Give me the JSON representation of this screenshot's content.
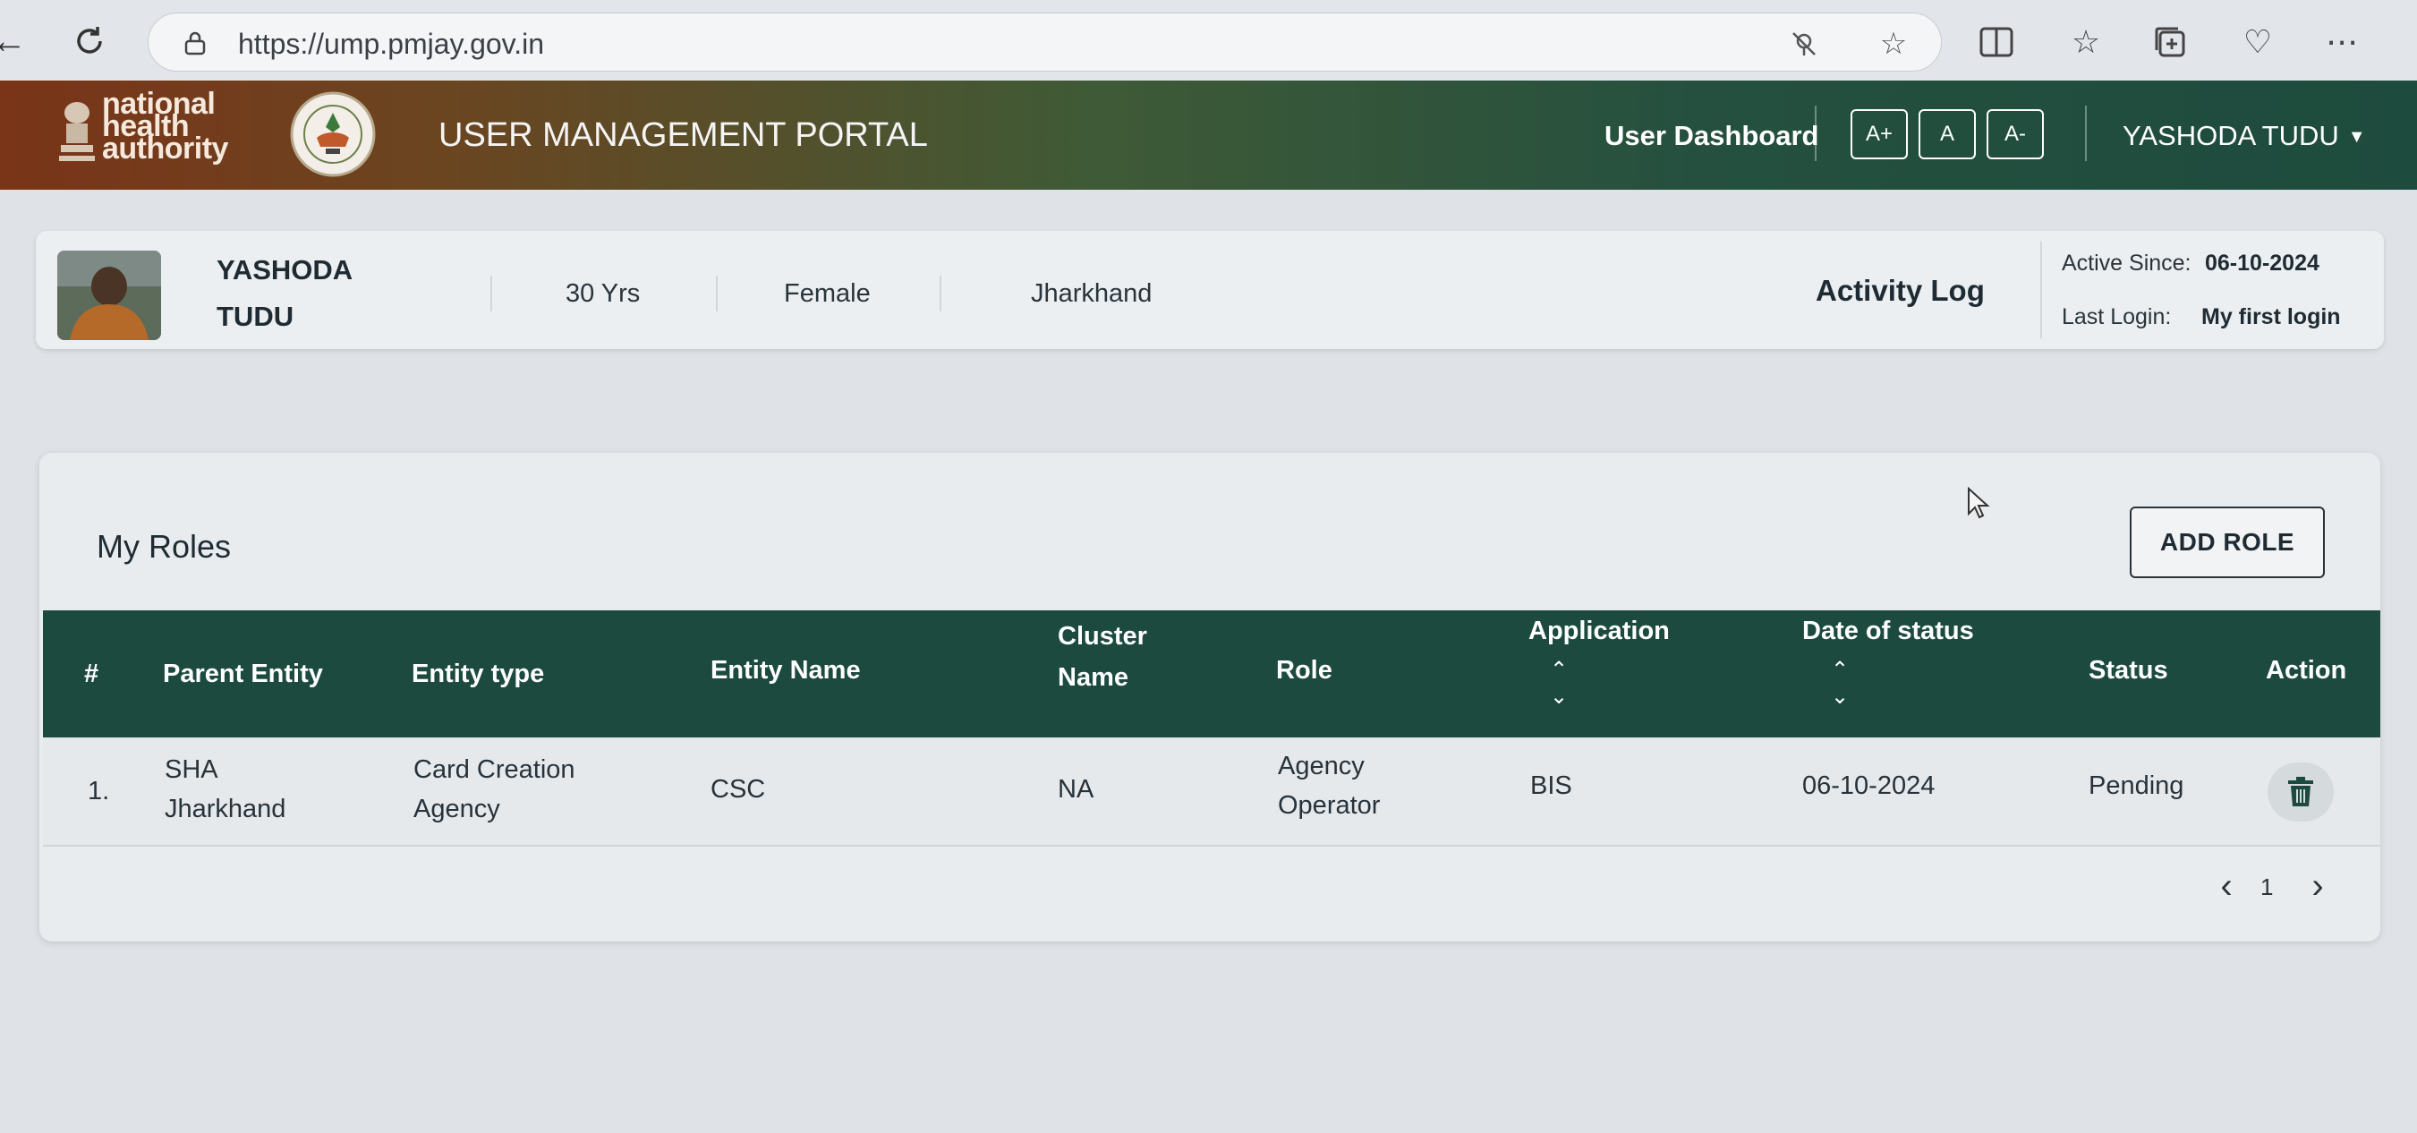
{
  "browser": {
    "url": "https://ump.pmjay.gov.in",
    "icons": [
      "back-icon",
      "refresh-icon",
      "lock-icon",
      "tracking-icon",
      "star-icon",
      "split-screen-icon",
      "favorites-icon",
      "collections-icon",
      "browser-health-icon",
      "more-icon"
    ]
  },
  "header": {
    "logo_lines": [
      "national",
      "health",
      "authority"
    ],
    "title": "USER MANAGEMENT PORTAL",
    "user_dashboard": "User Dashboard",
    "font_buttons": [
      "A+",
      "A",
      "A-"
    ],
    "user_name": "YASHODA TUDU"
  },
  "profile": {
    "first_name": "YASHODA",
    "last_name": "TUDU",
    "age": "30 Yrs",
    "gender": "Female",
    "state": "Jharkhand",
    "activity_log": "Activity Log",
    "active_since_label": "Active Since:",
    "active_since_value": "06-10-2024",
    "last_login_label": "Last Login:",
    "last_login_value": "My first login"
  },
  "roles": {
    "title": "My Roles",
    "add_role": "ADD ROLE",
    "columns": {
      "index": "#",
      "parent_entity": "Parent Entity",
      "entity_type": "Entity type",
      "entity_name": "Entity Name",
      "cluster_name_1": "Cluster",
      "cluster_name_2": "Name",
      "role": "Role",
      "application": "Application",
      "date_of_status": "Date of status",
      "status": "Status",
      "action": "Action"
    },
    "rows": [
      {
        "index": "1.",
        "parent_entity_1": "SHA",
        "parent_entity_2": "Jharkhand",
        "entity_type_1": "Card Creation",
        "entity_type_2": "Agency",
        "entity_name": "CSC",
        "cluster_name": "NA",
        "role_1": "Agency",
        "role_2": "Operator",
        "application": "BIS",
        "date_of_status": "06-10-2024",
        "status": "Pending"
      }
    ],
    "pagination": {
      "current_page": "1"
    }
  },
  "colors": {
    "header_start": "#7a3418",
    "header_end": "#1d4b3d",
    "table_header": "#1c4a3f",
    "page_background": "#dfe3e7"
  }
}
